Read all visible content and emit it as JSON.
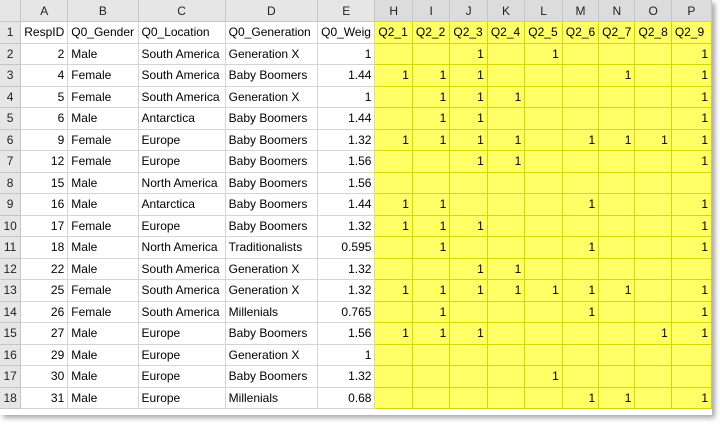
{
  "columns": [
    "A",
    "B",
    "C",
    "D",
    "E",
    "H",
    "I",
    "J",
    "K",
    "L",
    "M",
    "N",
    "O",
    "P"
  ],
  "header": [
    "RespID",
    "Q0_Gender",
    "Q0_Location",
    "Q0_Generation",
    "Q0_Weig",
    "Q2_1",
    "Q2_2",
    "Q2_3",
    "Q2_4",
    "Q2_5",
    "Q2_6",
    "Q2_7",
    "Q2_8",
    "Q2_9"
  ],
  "rows": [
    [
      "2",
      "Male",
      "South America",
      "Generation X",
      "1",
      "",
      "",
      "1",
      "",
      "1",
      "",
      "",
      "",
      "1"
    ],
    [
      "4",
      "Female",
      "South America",
      "Baby Boomers",
      "1.44",
      "1",
      "1",
      "1",
      "",
      "",
      "",
      "1",
      "",
      "1"
    ],
    [
      "5",
      "Female",
      "South America",
      "Generation X",
      "1",
      "",
      "1",
      "1",
      "1",
      "",
      "",
      "",
      "",
      "1"
    ],
    [
      "6",
      "Male",
      "Antarctica",
      "Baby Boomers",
      "1.44",
      "",
      "1",
      "1",
      "",
      "",
      "",
      "",
      "",
      "1"
    ],
    [
      "9",
      "Female",
      "Europe",
      "Baby Boomers",
      "1.32",
      "1",
      "1",
      "1",
      "1",
      "",
      "1",
      "1",
      "1",
      "1"
    ],
    [
      "12",
      "Female",
      "Europe",
      "Baby Boomers",
      "1.56",
      "",
      "",
      "1",
      "1",
      "",
      "",
      "",
      "",
      "1"
    ],
    [
      "15",
      "Male",
      "North America",
      "Baby Boomers",
      "1.56",
      "",
      "",
      "",
      "",
      "",
      "",
      "",
      "",
      ""
    ],
    [
      "16",
      "Male",
      "Antarctica",
      "Baby Boomers",
      "1.44",
      "1",
      "1",
      "",
      "",
      "",
      "1",
      "",
      "",
      "1"
    ],
    [
      "17",
      "Female",
      "Europe",
      "Baby Boomers",
      "1.32",
      "1",
      "1",
      "1",
      "",
      "",
      "",
      "",
      "",
      "1"
    ],
    [
      "18",
      "Male",
      "North America",
      "Traditionalists",
      "0.595",
      "",
      "1",
      "",
      "",
      "",
      "1",
      "",
      "",
      "1"
    ],
    [
      "22",
      "Male",
      "South America",
      "Generation X",
      "1.32",
      "",
      "",
      "1",
      "1",
      "",
      "",
      "",
      "",
      ""
    ],
    [
      "25",
      "Female",
      "South America",
      "Generation X",
      "1.32",
      "1",
      "1",
      "1",
      "1",
      "1",
      "1",
      "1",
      "",
      "1"
    ],
    [
      "26",
      "Female",
      "South America",
      "Millenials",
      "0.765",
      "",
      "1",
      "",
      "",
      "",
      "1",
      "",
      "",
      "1"
    ],
    [
      "27",
      "Male",
      "Europe",
      "Baby Boomers",
      "1.56",
      "1",
      "1",
      "1",
      "",
      "",
      "",
      "",
      "1",
      "1"
    ],
    [
      "29",
      "Male",
      "Europe",
      "Generation X",
      "1",
      "",
      "",
      "",
      "",
      "",
      "",
      "",
      "",
      ""
    ],
    [
      "30",
      "Male",
      "Europe",
      "Baby Boomers",
      "1.32",
      "",
      "",
      "",
      "",
      "1",
      "",
      "",
      "",
      ""
    ],
    [
      "31",
      "Male",
      "Europe",
      "Millenials",
      "0.68",
      "",
      "",
      "",
      "",
      "",
      "1",
      "1",
      "",
      "1"
    ]
  ]
}
